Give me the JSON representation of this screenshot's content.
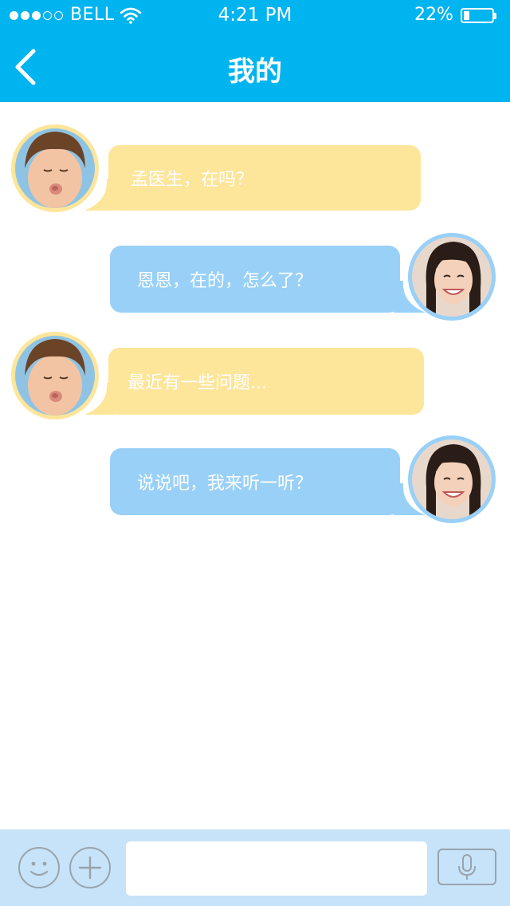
{
  "status_bar": {
    "carrier": "BELL",
    "time": "4:21 PM",
    "battery_percent": "22%",
    "battery_level": 0.22,
    "signal_strength": 3,
    "signal_max": 5
  },
  "nav": {
    "title": "我的",
    "back_icon": "chevron-left-icon"
  },
  "colors": {
    "header": "#00b4ef",
    "incoming_bubble": "#fde59a",
    "outgoing_bubble": "#99d0f8",
    "input_bar": "#c6e3f9"
  },
  "messages": [
    {
      "sender": "patient",
      "direction": "incoming",
      "text": "孟医生，在吗？"
    },
    {
      "sender": "doctor",
      "direction": "outgoing",
      "text": "恩恩，在的，怎么了？"
    },
    {
      "sender": "patient",
      "direction": "incoming",
      "text": "最近有一些问题..."
    },
    {
      "sender": "doctor",
      "direction": "outgoing",
      "text": "说说吧，我来听一听？"
    }
  ],
  "input_bar": {
    "emoji_icon": "smiley-icon",
    "add_icon": "plus-icon",
    "mic_icon": "microphone-icon",
    "input_value": "",
    "input_placeholder": ""
  }
}
